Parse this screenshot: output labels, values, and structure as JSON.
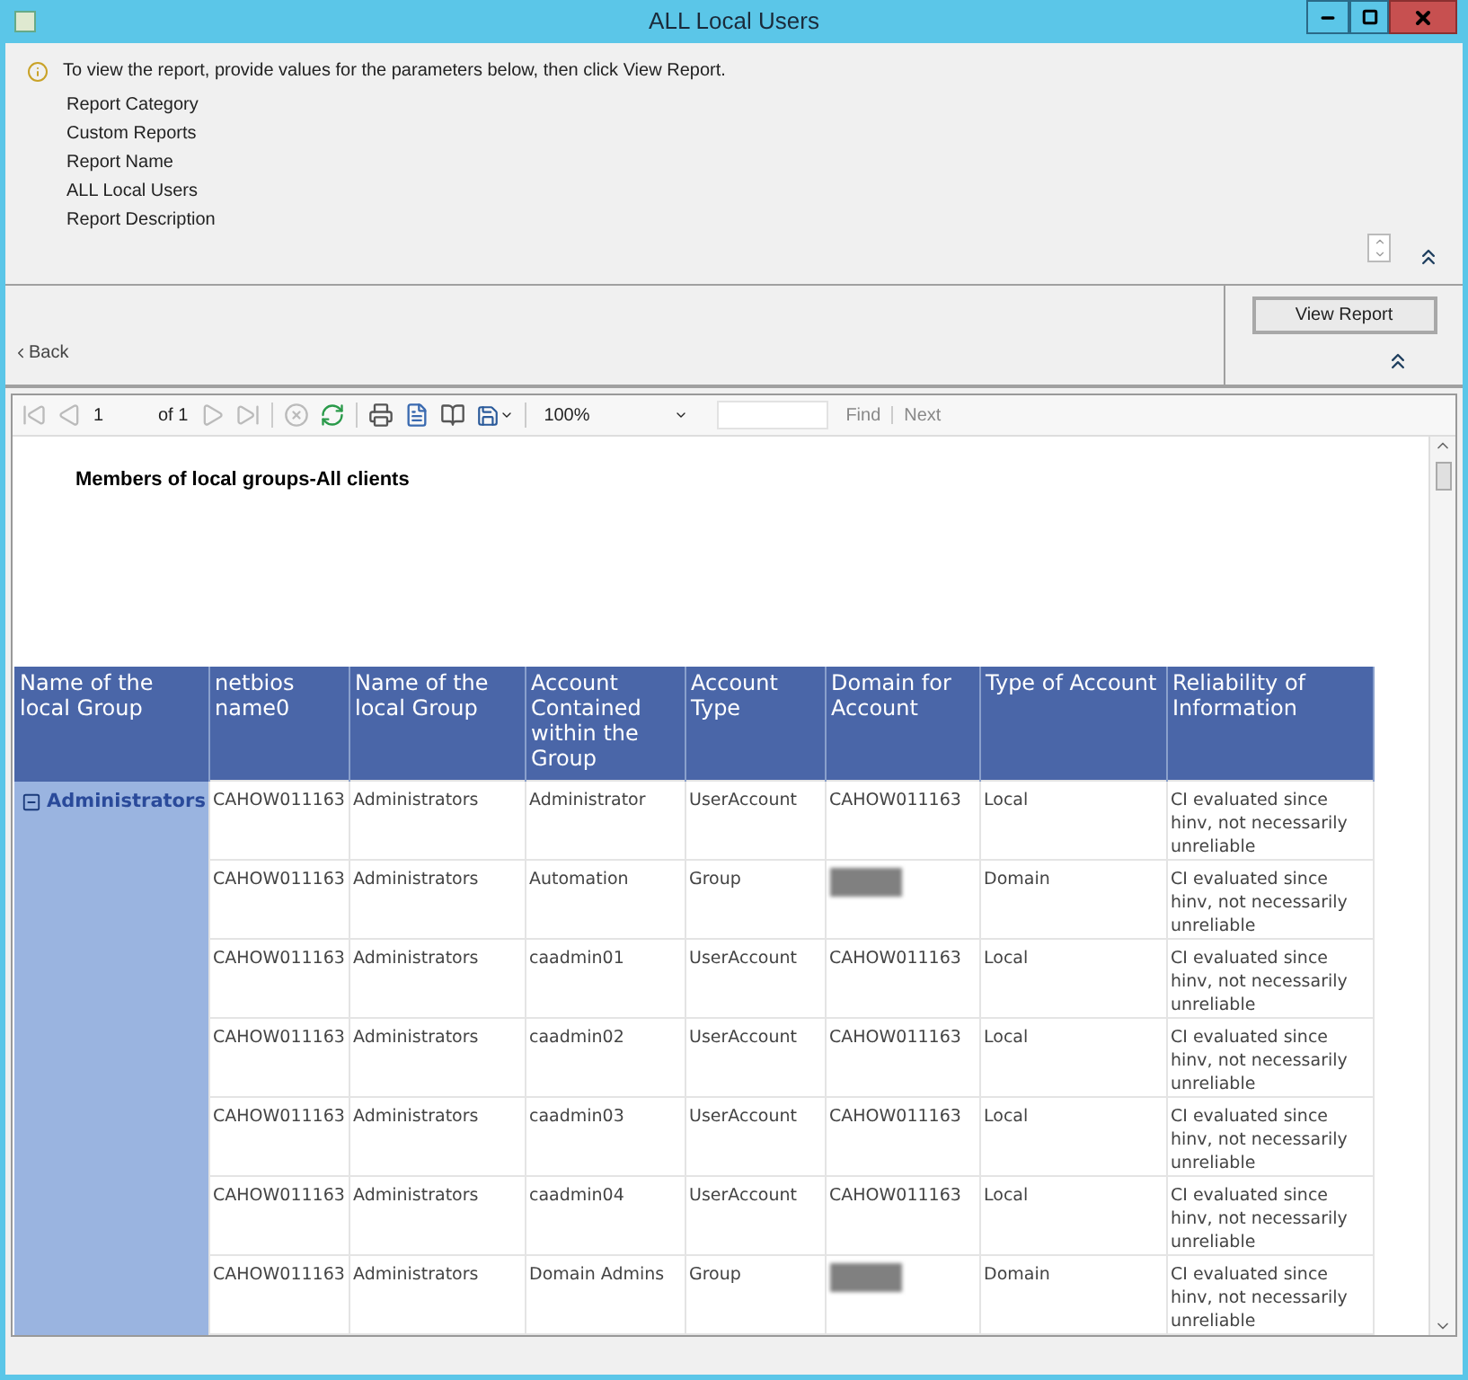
{
  "window": {
    "title": "ALL Local Users"
  },
  "parameters": {
    "hint": "To view the report, provide values for the parameters below, then click View Report.",
    "items": [
      {
        "label": "Report Category",
        "value": "Custom Reports"
      },
      {
        "label": "Report Name",
        "value": "ALL Local Users"
      },
      {
        "label": "Report Description"
      }
    ]
  },
  "back": "Back",
  "view_report": "View Report",
  "toolbar": {
    "page": "1",
    "of": "of 1",
    "zoom": "100%",
    "find": "Find",
    "next": "Next"
  },
  "report": {
    "title": "Members of local groups-All clients",
    "columns": [
      "Name of the local Group",
      "netbios name0",
      "Name of the local Group",
      "Account Contained within the Group",
      "Account Type",
      "Domain for Account",
      "Type of Account",
      "Reliability of Information"
    ],
    "group": {
      "name": "Administrators",
      "expanded": true
    },
    "rows": [
      {
        "netbios": "CAHOW011163",
        "group": "Administrators",
        "account": "Administrator",
        "account_type": "UserAccount",
        "domain": "CAHOW011163",
        "type": "Local",
        "reliability": "CI evaluated since hinv, not necessarily unreliable"
      },
      {
        "netbios": "CAHOW011163",
        "group": "Administrators",
        "account": "Automation",
        "account_type": "Group",
        "domain": null,
        "type": "Domain",
        "reliability": "CI evaluated since hinv, not necessarily unreliable"
      },
      {
        "netbios": "CAHOW011163",
        "group": "Administrators",
        "account": "caadmin01",
        "account_type": "UserAccount",
        "domain": "CAHOW011163",
        "type": "Local",
        "reliability": "CI evaluated since hinv, not necessarily unreliable"
      },
      {
        "netbios": "CAHOW011163",
        "group": "Administrators",
        "account": "caadmin02",
        "account_type": "UserAccount",
        "domain": "CAHOW011163",
        "type": "Local",
        "reliability": "CI evaluated since hinv, not necessarily unreliable"
      },
      {
        "netbios": "CAHOW011163",
        "group": "Administrators",
        "account": "caadmin03",
        "account_type": "UserAccount",
        "domain": "CAHOW011163",
        "type": "Local",
        "reliability": "CI evaluated since hinv, not necessarily unreliable"
      },
      {
        "netbios": "CAHOW011163",
        "group": "Administrators",
        "account": "caadmin04",
        "account_type": "UserAccount",
        "domain": "CAHOW011163",
        "type": "Local",
        "reliability": "CI evaluated since hinv, not necessarily unreliable"
      },
      {
        "netbios": "CAHOW011163",
        "group": "Administrators",
        "account": "Domain Admins",
        "account_type": "Group",
        "domain": null,
        "type": "Domain",
        "reliability": "CI evaluated since hinv, not necessarily unreliable"
      }
    ]
  }
}
